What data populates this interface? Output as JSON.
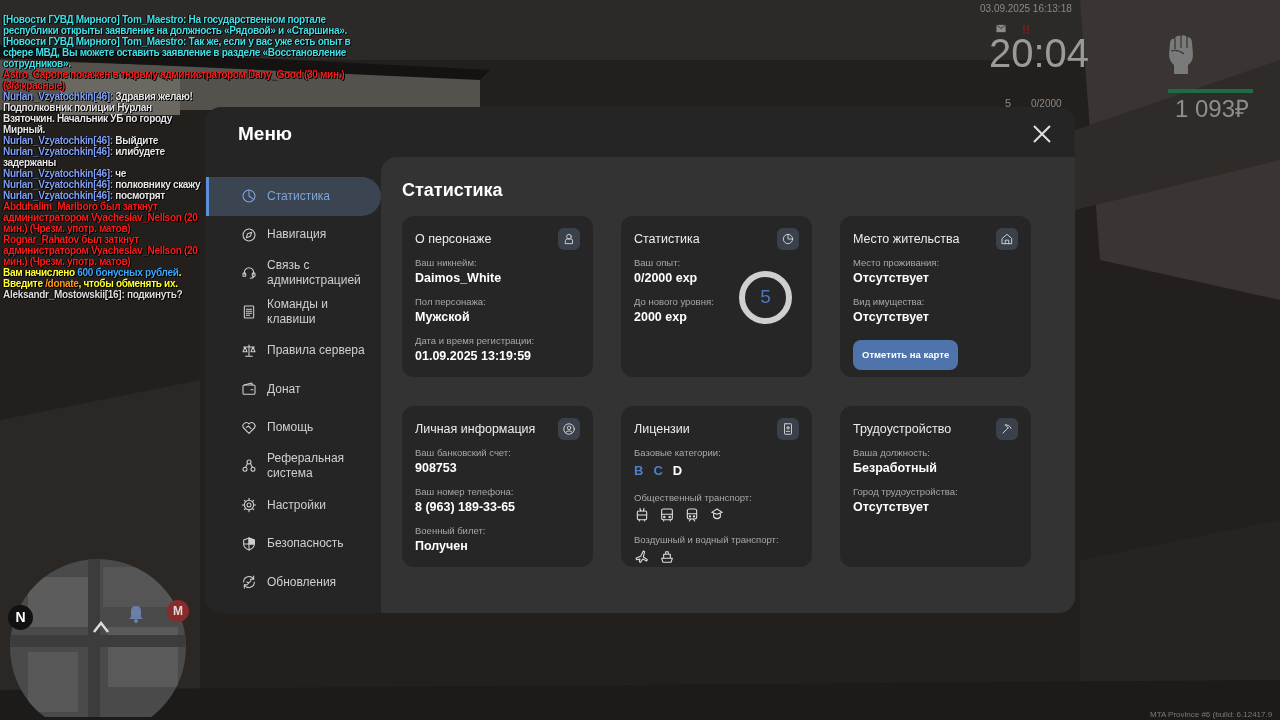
{
  "chat": [
    {
      "segments": [
        {
          "text": "[Новости ГУВД Мирного] Tom_Maestro: На государственном портале республики открыты заявление на должность «Рядовой» и «Старшина».",
          "color": "#3fe0e8"
        }
      ]
    },
    {
      "segments": [
        {
          "text": "[Новости ГУВД Мирного] Tom_Maestro: Так же, если у вас уже есть опыт в сфере МВД, Вы можете оставить заявление в разделе «Восстановление сотрудников».",
          "color": "#3fe0e8"
        }
      ]
    },
    {
      "segments": [
        {
          "text": "Astro_Capone посажен в тюрьму администратором Dany_Good (30 мин.) (3/3 красные)",
          "color": "#ff1a1a"
        }
      ]
    },
    {
      "segments": [
        {
          "text": "Nurlan_Vzyatochkin[46]:",
          "color": "#7f9ff5"
        },
        {
          "text": " Здравия желаю! Подполковник полиции Нурлан Взяточкин. Начальник УБ по городу Мирный.",
          "color": "#e6e6e6"
        }
      ]
    },
    {
      "segments": [
        {
          "text": "Nurlan_Vzyatochkin[46]:",
          "color": "#7f9ff5"
        },
        {
          "text": " Выйдите",
          "color": "#e6e6e6"
        }
      ]
    },
    {
      "segments": [
        {
          "text": "Nurlan_Vzyatochkin[46]:",
          "color": "#7f9ff5"
        },
        {
          "text": " илибудете задержаны",
          "color": "#e6e6e6"
        }
      ]
    },
    {
      "segments": [
        {
          "text": "Nurlan_Vzyatochkin[46]:",
          "color": "#7f9ff5"
        },
        {
          "text": " че",
          "color": "#e6e6e6"
        }
      ]
    },
    {
      "segments": [
        {
          "text": "Nurlan_Vzyatochkin[46]:",
          "color": "#7f9ff5"
        },
        {
          "text": " полковнику скажу",
          "color": "#e6e6e6"
        }
      ]
    },
    {
      "segments": [
        {
          "text": "Nurlan_Vzyatochkin[46]:",
          "color": "#7f9ff5"
        },
        {
          "text": " посмотрят",
          "color": "#e6e6e6"
        }
      ]
    },
    {
      "segments": [
        {
          "text": "Abduhalim_Marlboro был заткнут администратором Vyacheslav_Nellson (20 мин.) (Чрезм. употр. матов)",
          "color": "#ff1a1a"
        }
      ]
    },
    {
      "segments": [
        {
          "text": "Rognar_Rahatov был заткнут администратором Vyacheslav_Nellson (20 мин.) (Чрезм. употр. матов)",
          "color": "#ff1a1a"
        }
      ]
    },
    {
      "segments": [
        {
          "text": "Вам начислено ",
          "color": "#ffff33"
        },
        {
          "text": "600 бонусных рублей",
          "color": "#3aa8ff"
        },
        {
          "text": ". Введите ",
          "color": "#ffff33"
        },
        {
          "text": "/donate",
          "color": "#ff9a1a"
        },
        {
          "text": ", чтобы обменять их.",
          "color": "#ffff33"
        }
      ]
    },
    {
      "segments": [
        {
          "text": "Aleksandr_Mostowskii[16]: подкинуть?",
          "color": "#dcdcdc"
        }
      ]
    }
  ],
  "hud": {
    "datetime": "03.09.2025 16:13:18",
    "alert": "!!",
    "clock": "20:04",
    "rank": "5",
    "experience": "0/2000",
    "health": {
      "level": 1
    },
    "money": "1 093₽"
  },
  "minimap": {
    "north": "N",
    "marker": "M"
  },
  "menu": {
    "title": "Меню",
    "items": [
      {
        "label": "Статистика",
        "selected": true
      },
      {
        "label": "Навигация",
        "selected": false
      },
      {
        "label": "Связь с администрацией",
        "selected": false
      },
      {
        "label": "Команды и клавиши",
        "selected": false
      },
      {
        "label": "Правила сервера",
        "selected": false
      },
      {
        "label": "Донат",
        "selected": false
      },
      {
        "label": "Помощь",
        "selected": false
      },
      {
        "label": "Реферальная система",
        "selected": false
      },
      {
        "label": "Настройки",
        "selected": false
      },
      {
        "label": "Безопасность",
        "selected": false
      },
      {
        "label": "Обновления",
        "selected": false
      }
    ]
  },
  "page": {
    "title": "Статистика",
    "cards": [
      {
        "kind": "character",
        "title": "О персонаже",
        "fields": [
          {
            "label": "Ваш никнейм:",
            "value": "Daimos_White"
          },
          {
            "label": "Пол персонажа:",
            "value": "Мужской"
          },
          {
            "label": "Дата и время регистрации:",
            "value": "01.09.2025 13:19:59"
          }
        ]
      },
      {
        "kind": "stats",
        "title": "Статистика",
        "fields": [
          {
            "label": "Ваш опыт:",
            "value": "0/2000 exp"
          },
          {
            "label": "До нового уровня:",
            "value": "2000 exp"
          }
        ],
        "ring": "5"
      },
      {
        "kind": "residence",
        "title": "Место жительства",
        "fields": [
          {
            "label": "Место проживания:",
            "value": "Отсутствует"
          },
          {
            "label": "Вид имущества:",
            "value": "Отсутствует"
          }
        ],
        "button": "Отметить на карте"
      },
      {
        "kind": "personal",
        "title": "Личная информация",
        "fields": [
          {
            "label": "Ваш банковский счет:",
            "value": "908753"
          },
          {
            "label": "Ваш номер телефона:",
            "value": "8 (963) 189-33-65"
          },
          {
            "label": "Военный билет:",
            "value": "Получен"
          }
        ]
      },
      {
        "kind": "licenses",
        "title": "Лицензии",
        "categories_label": "Базовые категории:",
        "categories": [
          {
            "letter": "B",
            "active": true
          },
          {
            "letter": "C",
            "active": true
          },
          {
            "letter": "D",
            "active": false
          }
        ],
        "transport_groups": [
          {
            "kind": "public",
            "label": "Общественный транспорт:"
          },
          {
            "kind": "air_water",
            "label": "Воздушный и водный транспорт:"
          }
        ]
      },
      {
        "kind": "employment",
        "title": "Трудоустройство",
        "fields": [
          {
            "label": "Ваша должность:",
            "value": "Безработный"
          },
          {
            "label": "Город трудоустройства:",
            "value": "Отсутствует"
          }
        ]
      }
    ]
  },
  "build": "MTA Province #6 (build: 6.12417.9"
}
